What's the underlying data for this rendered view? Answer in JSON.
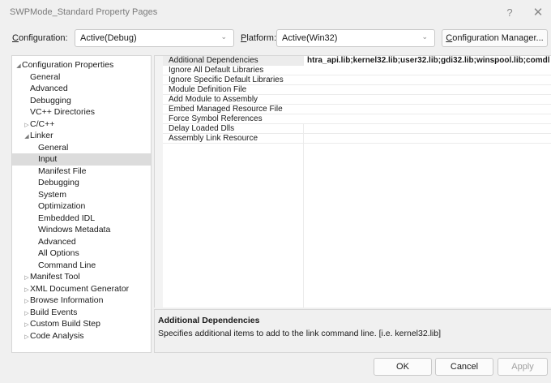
{
  "window": {
    "title": "SWPMode_Standard Property Pages",
    "help_glyph": "?",
    "close_glyph": "✕"
  },
  "config_bar": {
    "configuration_label": "onfiguration:",
    "configuration_label_accel": "C",
    "configuration_value": "Active(Debug)",
    "platform_label": "latform:",
    "platform_label_accel": "P",
    "platform_value": "Active(Win32)",
    "manager_button": "onfiguration Manager...",
    "manager_button_accel": "C"
  },
  "tree": {
    "items": [
      {
        "label": "Configuration Properties",
        "level": 0,
        "arrow": "expanded"
      },
      {
        "label": "General",
        "level": 1,
        "arrow": "none"
      },
      {
        "label": "Advanced",
        "level": 1,
        "arrow": "none"
      },
      {
        "label": "Debugging",
        "level": 1,
        "arrow": "none"
      },
      {
        "label": "VC++ Directories",
        "level": 1,
        "arrow": "none"
      },
      {
        "label": "C/C++",
        "level": 1,
        "arrow": "collapsed"
      },
      {
        "label": "Linker",
        "level": 1,
        "arrow": "expanded"
      },
      {
        "label": "General",
        "level": 2,
        "arrow": "none"
      },
      {
        "label": "Input",
        "level": 2,
        "arrow": "none",
        "selected": true
      },
      {
        "label": "Manifest File",
        "level": 2,
        "arrow": "none"
      },
      {
        "label": "Debugging",
        "level": 2,
        "arrow": "none"
      },
      {
        "label": "System",
        "level": 2,
        "arrow": "none"
      },
      {
        "label": "Optimization",
        "level": 2,
        "arrow": "none"
      },
      {
        "label": "Embedded IDL",
        "level": 2,
        "arrow": "none"
      },
      {
        "label": "Windows Metadata",
        "level": 2,
        "arrow": "none"
      },
      {
        "label": "Advanced",
        "level": 2,
        "arrow": "none"
      },
      {
        "label": "All Options",
        "level": 2,
        "arrow": "none"
      },
      {
        "label": "Command Line",
        "level": 2,
        "arrow": "none"
      },
      {
        "label": "Manifest Tool",
        "level": 1,
        "arrow": "collapsed"
      },
      {
        "label": "XML Document Generator",
        "level": 1,
        "arrow": "collapsed"
      },
      {
        "label": "Browse Information",
        "level": 1,
        "arrow": "collapsed"
      },
      {
        "label": "Build Events",
        "level": 1,
        "arrow": "collapsed"
      },
      {
        "label": "Custom Build Step",
        "level": 1,
        "arrow": "collapsed"
      },
      {
        "label": "Code Analysis",
        "level": 1,
        "arrow": "collapsed"
      }
    ]
  },
  "grid": {
    "rows": [
      {
        "name": "Additional Dependencies",
        "value": "htra_api.lib;kernel32.lib;user32.lib;gdi32.lib;winspool.lib;comdl"
      },
      {
        "name": "Ignore All Default Libraries",
        "value": ""
      },
      {
        "name": "Ignore Specific Default Libraries",
        "value": ""
      },
      {
        "name": "Module Definition File",
        "value": ""
      },
      {
        "name": "Add Module to Assembly",
        "value": ""
      },
      {
        "name": "Embed Managed Resource File",
        "value": ""
      },
      {
        "name": "Force Symbol References",
        "value": ""
      },
      {
        "name": "Delay Loaded Dlls",
        "value": ""
      },
      {
        "name": "Assembly Link Resource",
        "value": ""
      }
    ]
  },
  "description": {
    "title": "Additional Dependencies",
    "text": "Specifies additional items to add to the link command line. [i.e. kernel32.lib]"
  },
  "buttons": {
    "ok": "OK",
    "cancel": "Cancel",
    "apply": "Apply"
  },
  "icons": {
    "expanded": "tree-expanded-triangle",
    "collapsed": "tree-collapsed-triangle",
    "dropdown": "chevron-down"
  },
  "colors": {
    "selection": "#dcdcdc",
    "window_bg": "#f0f0f0",
    "panel_bg": "#ffffff",
    "border": "#d6d6d6"
  }
}
